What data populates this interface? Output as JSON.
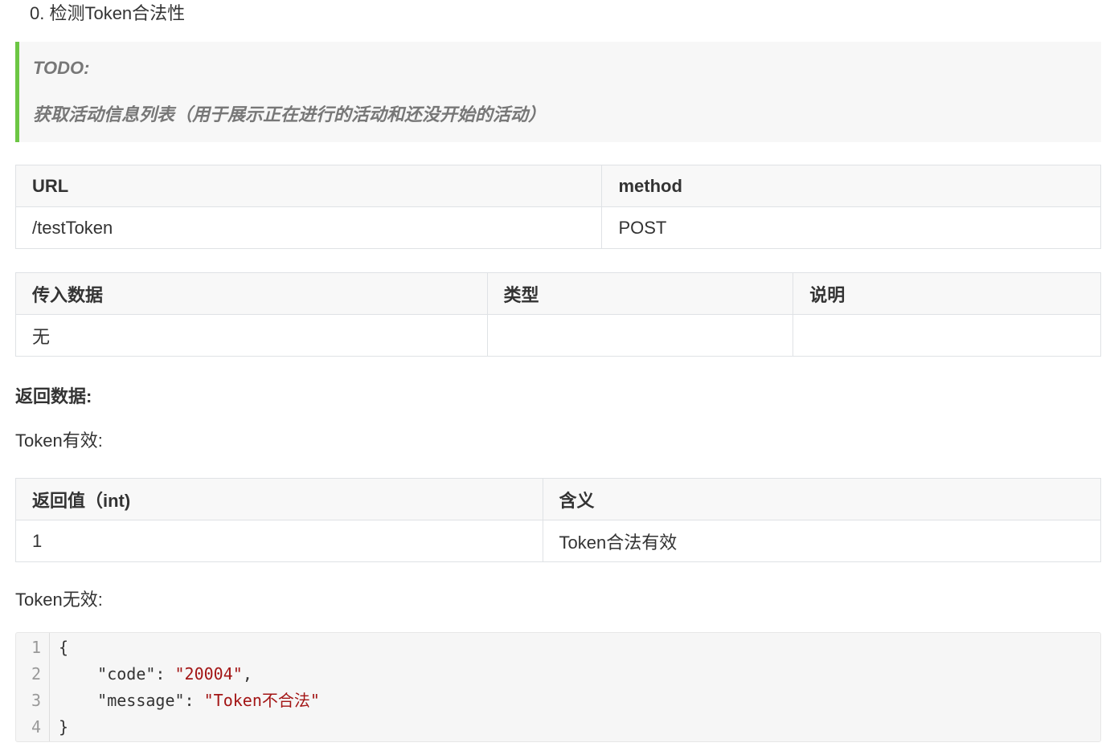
{
  "heading": "0. 检测Token合法性",
  "todo": {
    "title": "TODO:",
    "description": "获取活动信息列表（用于展示正在进行的活动和还没开始的活动）",
    "accent_color": "#6cc644"
  },
  "endpoint_table": {
    "headers": [
      "URL",
      "method"
    ],
    "rows": [
      [
        "/testToken",
        "POST"
      ]
    ]
  },
  "input_table": {
    "headers": [
      "传入数据",
      "类型",
      "说明"
    ],
    "rows": [
      [
        "无",
        "",
        ""
      ]
    ]
  },
  "return_section": {
    "title": "返回数据:",
    "valid_label": "Token有效:",
    "invalid_label": "Token无效:"
  },
  "return_table": {
    "headers": [
      "返回值（int)",
      "含义"
    ],
    "rows": [
      [
        "1",
        "Token合法有效"
      ]
    ]
  },
  "code": {
    "line_numbers": [
      "1",
      "2",
      "3",
      "4"
    ],
    "open_brace": "{",
    "close_brace": "}",
    "key1": "\"code\"",
    "value1": "\"20004\"",
    "key2": "\"message\"",
    "value2": "\"Token不合法\"",
    "colon": ": ",
    "comma": ",",
    "string_color": "#a31515"
  }
}
